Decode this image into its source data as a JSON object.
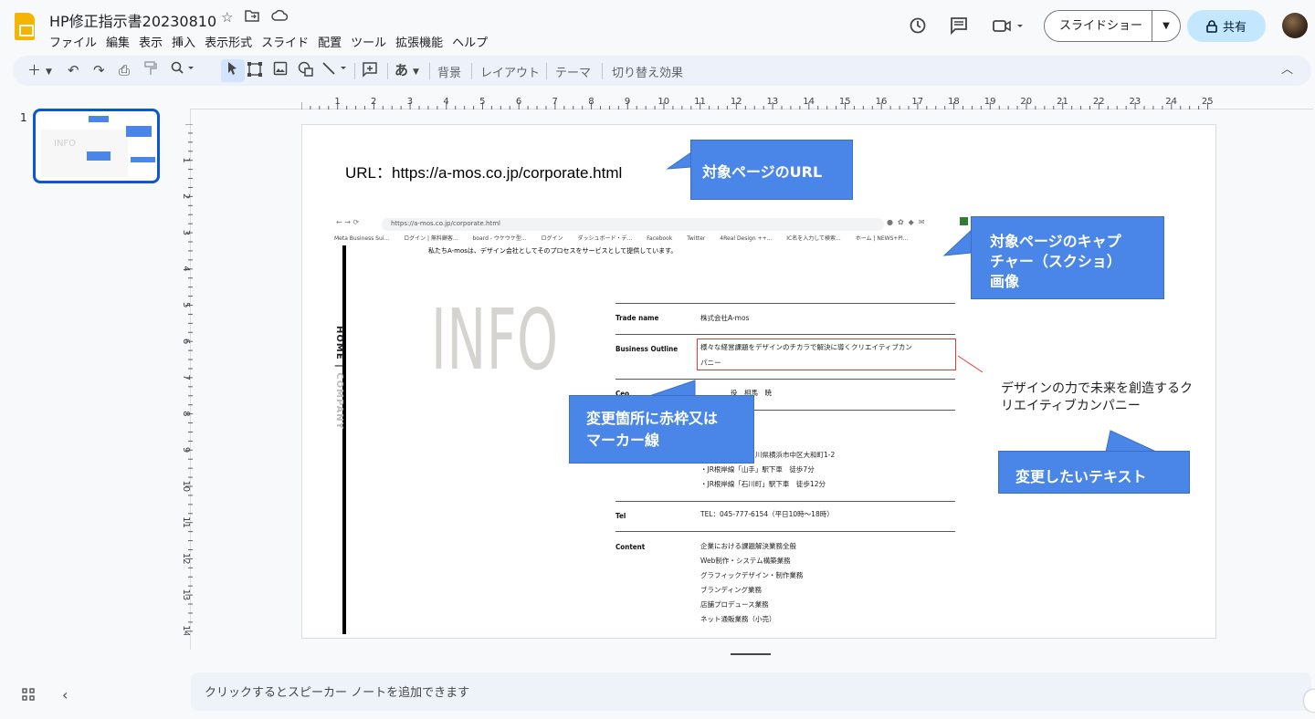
{
  "header": {
    "doc_title": "HP修正指示書20230810",
    "menus": [
      "ファイル",
      "編集",
      "表示",
      "挿入",
      "表示形式",
      "スライド",
      "配置",
      "ツール",
      "拡張機能",
      "ヘルプ"
    ],
    "slideshow_label": "スライドショー",
    "share_label": "共有",
    "share_icon": "lock-icon"
  },
  "toolbar": {
    "background_label": "背景",
    "layout_label": "レイアウト",
    "theme_label": "テーマ",
    "transition_label": "切り替え効果",
    "input_label": "あ"
  },
  "filmstrip": {
    "slide_number": "1"
  },
  "ruler": {
    "top_numbers": [
      "1",
      "2",
      "3",
      "4",
      "5",
      "6",
      "7",
      "8",
      "9",
      "10",
      "11",
      "12",
      "13",
      "14",
      "15",
      "16",
      "17",
      "18",
      "19",
      "20",
      "21",
      "22",
      "23",
      "24",
      "25"
    ],
    "left_numbers": [
      "1",
      "2",
      "3",
      "4",
      "5",
      "6",
      "7",
      "8",
      "9",
      "10",
      "11",
      "12",
      "13",
      "14"
    ]
  },
  "slide": {
    "url_text": "URL：https://a-mos.co.jp/corporate.html",
    "callout_url": "対象ページのURL",
    "callout_capture": [
      "対象ページのキャプ",
      "チャー（スクショ）",
      "画像"
    ],
    "callout_marker": [
      "変更箇所に赤枠又は",
      "マーカー線"
    ],
    "callout_text": "変更したいテキスト",
    "new_text": "デザインの力で未来を創造するクリエイティブカンパニー",
    "colors": {
      "callout_blue": "#4a86e8",
      "marker_red": "#e53935"
    }
  },
  "screenshot": {
    "url": "https://a-mos.co.jp/corporate.html",
    "bookmarks": [
      "Meta Business Sui...",
      "ログイン | 無料顧客...",
      "board - ウケウケ型...",
      "ログイン",
      "ダッシュボード・デ...",
      "Facebook",
      "Twitter",
      "4Real Design ++...",
      "IC名を入力して検索...",
      "ホーム | NEWS+Pl..."
    ],
    "tagline": "私たちA-mosは、デザイン会社としてそのプロセスをサービスとして提供しています。",
    "side_home": "HOME",
    "side_company": "COMPANY",
    "big_word": "INFO",
    "rows": [
      {
        "label": "Trade name",
        "lines": [
          "株式会社A-mos"
        ]
      },
      {
        "label": "Business Outline",
        "lines": [
          "様々な経営課題をデザインのチカラで解決に導くクリエイティブカン",
          "パニー"
        ]
      },
      {
        "label": "Ceo",
        "lines": [
          "役　相馬　暁"
        ]
      },
      {
        "label": "",
        "lines": [
          "川県横浜市中区大和町1-2",
          "・JR根岸線「山手」駅下車　徒歩7分",
          "・JR根岸線「石川町」駅下車　徒歩12分"
        ]
      },
      {
        "label": "Tel",
        "lines": [
          "TEL：045-777-6154（平日10時〜18時）"
        ]
      },
      {
        "label": "Content",
        "lines": [
          "企業における課題解決業務全般",
          "Web制作・システム構築業務",
          "グラフィックデザイン・制作業務",
          "ブランディング業務",
          "店舗プロデュース業務",
          "ネット通販業務（小売）"
        ]
      }
    ]
  },
  "notes": {
    "placeholder": "クリックするとスピーカー ノートを追加できます"
  }
}
